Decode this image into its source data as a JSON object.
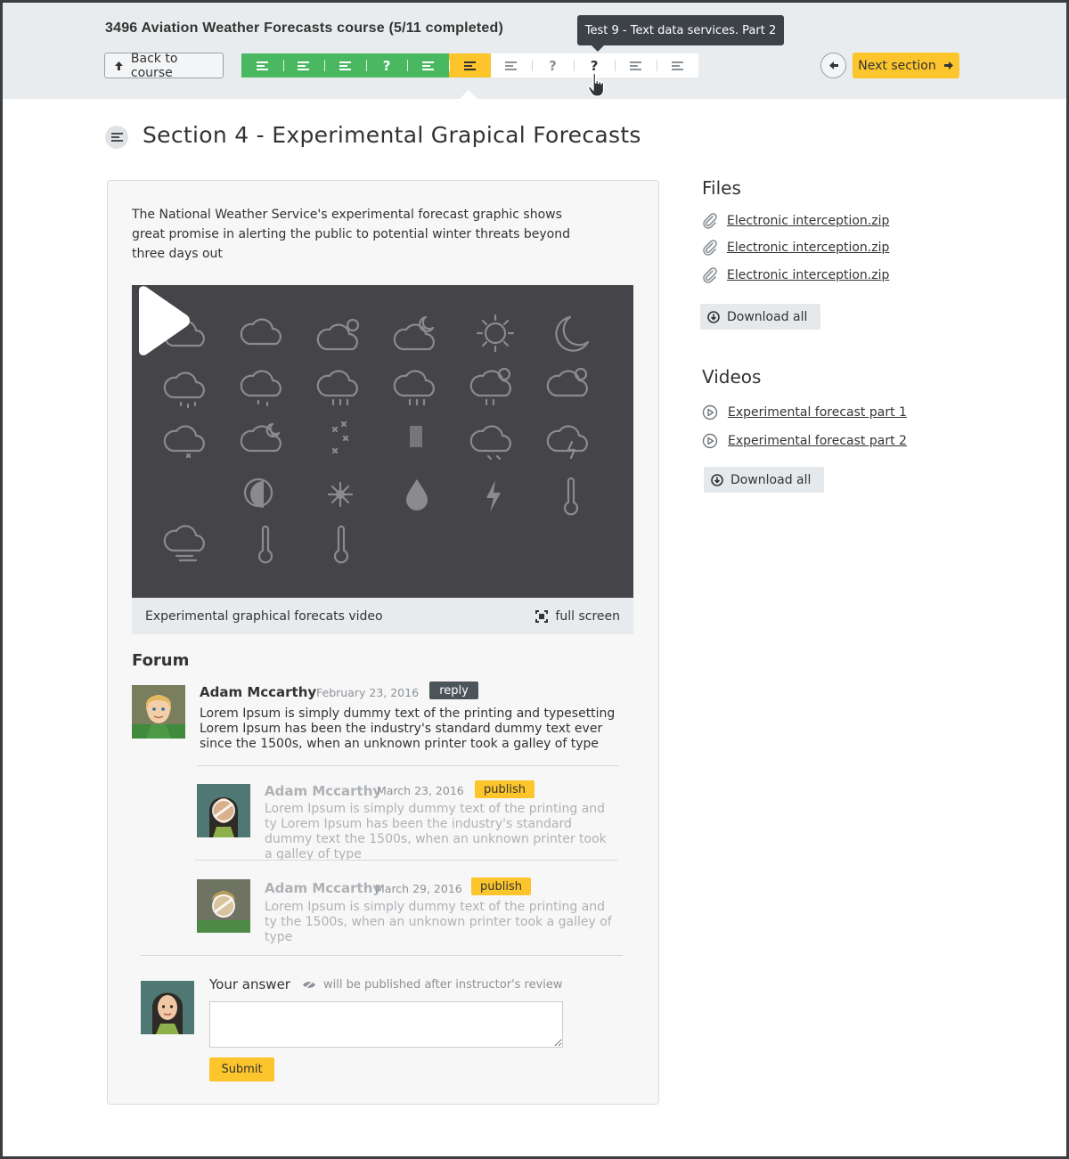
{
  "header": {
    "course_title": "3496 Aviation Weather Forecasts course (5/11 completed)",
    "back_label": "Back to course",
    "next_label": "Next section",
    "tooltip": "Test 9 - Text data services. Part 2",
    "progress": {
      "completed": 5,
      "total": 11,
      "segments": [
        {
          "type": "text",
          "state": "done"
        },
        {
          "type": "text",
          "state": "done"
        },
        {
          "type": "text",
          "state": "done"
        },
        {
          "type": "test",
          "state": "done"
        },
        {
          "type": "text",
          "state": "done"
        },
        {
          "type": "text",
          "state": "current"
        },
        {
          "type": "text",
          "state": "todo"
        },
        {
          "type": "test",
          "state": "todo"
        },
        {
          "type": "test",
          "state": "hover"
        },
        {
          "type": "text",
          "state": "todo"
        },
        {
          "type": "text",
          "state": "todo"
        }
      ],
      "test_glyph": "?"
    },
    "icons": {
      "back": "arrow-up-icon",
      "prev": "arrow-left-icon",
      "next": "arrow-right-icon",
      "cursor": "hand-pointer-icon"
    }
  },
  "section": {
    "title": "Section 4 - Experimental Grapical Forecasts",
    "icon": "text-lines-icon"
  },
  "content": {
    "intro": "The National Weather Service's experimental forecast graphic shows great promise in alerting the public to potential winter threats beyond three days out",
    "video_caption": "Experimental graphical forecats video",
    "fullscreen_label": "full screen"
  },
  "forum": {
    "title": "Forum",
    "comments": [
      {
        "author": "Adam Mccarthy",
        "date": "February 23, 2016",
        "badge": "reply",
        "text": "Lorem Ipsum is simply dummy text of the printing and typesetting Lorem Ipsum has been the industry's standard dummy text ever since the 1500s, when an unknown printer took a galley of type"
      },
      {
        "author": "Adam Mccarthy",
        "date": "March 23, 2016",
        "badge": "publish",
        "text": "Lorem Ipsum is simply dummy text of the printing and ty Lorem Ipsum has been the industry's standard dummy text the 1500s, when an unknown printer took a galley of type"
      },
      {
        "author": "Adam Mccarthy",
        "date": "March 29, 2016",
        "badge": "publish",
        "text": "Lorem Ipsum is simply dummy text of the printing and ty the 1500s, when an unknown printer took a galley of type"
      }
    ],
    "answer": {
      "label": "Your answer",
      "note": "will be published after instructor's review",
      "input_value": "",
      "submit_label": "Submit"
    }
  },
  "sidebar": {
    "files_title": "Files",
    "files": [
      "Electronic interception.zip",
      "Electronic interception.zip",
      "Electronic interception.zip"
    ],
    "files_download": "Download all",
    "videos_title": "Videos",
    "videos": [
      "Experimental forecast part 1",
      "Experimental forecast part 2"
    ],
    "videos_download": "Download all"
  },
  "colors": {
    "done": "#49b860",
    "current": "#fcc52c",
    "accent": "#fcc52c",
    "header_bg": "#e9ecee",
    "dark": "#3c4247"
  }
}
